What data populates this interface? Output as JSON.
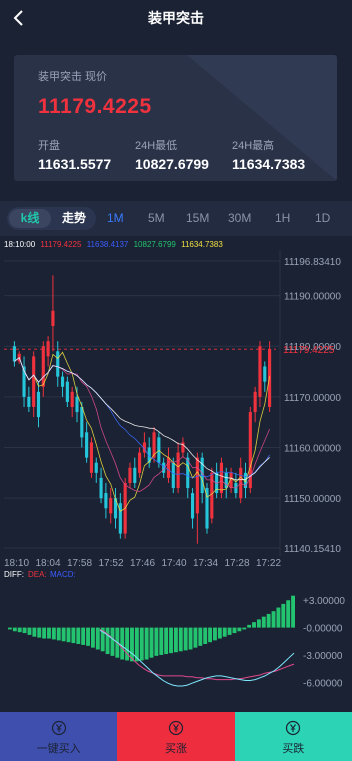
{
  "header": {
    "title": "装甲突击"
  },
  "ticker": {
    "symbol_label": "装甲突击 现价",
    "price": "11179.4225",
    "open_label": "开盘",
    "open_value": "11631.5577",
    "low_label": "24H最低",
    "low_value": "10827.6799",
    "high_label": "24H最高",
    "high_value": "11634.7383"
  },
  "chart_tabs": {
    "kline": "k线",
    "trend": "走势",
    "timeframes": [
      "1M",
      "5M",
      "15M",
      "30M",
      "1H",
      "1D"
    ],
    "active_timeframe": "1M"
  },
  "legend": {
    "time": "18:10:00",
    "v1": "11179.4225",
    "v2": "11638.4137",
    "v3": "10827.6799",
    "v4": "11634.7383"
  },
  "chart_data": [
    {
      "type": "candlestick",
      "y_ticks": [
        "11196.83410",
        "11190.00000",
        "11180.00000",
        "11170.00000",
        "11160.00000",
        "11150.00000",
        "11140.15410"
      ],
      "ylim": [
        11140.1541,
        11196.8341
      ],
      "x_ticks": [
        "18:10",
        "18:04",
        "17:58",
        "17:52",
        "17:46",
        "17:40",
        "17:34",
        "17:28",
        "17:22"
      ],
      "current_price_label": "11179.4225",
      "current_price": 11179.4225,
      "candles": [
        {
          "o": 11180,
          "c": 11177,
          "h": 11181,
          "l": 11176
        },
        {
          "o": 11177,
          "c": 11178.5,
          "h": 11179,
          "l": 11176.5
        },
        {
          "o": 11176,
          "c": 11170,
          "h": 11178,
          "l": 11168
        },
        {
          "o": 11170,
          "c": 11168,
          "h": 11172,
          "l": 11167
        },
        {
          "o": 11168,
          "c": 11178,
          "h": 11179,
          "l": 11166
        },
        {
          "o": 11171,
          "c": 11166,
          "h": 11173,
          "l": 11164
        },
        {
          "o": 11172,
          "c": 11180,
          "h": 11181,
          "l": 11170
        },
        {
          "o": 11178,
          "c": 11181,
          "h": 11182,
          "l": 11176
        },
        {
          "o": 11184,
          "c": 11187,
          "h": 11194,
          "l": 11179
        },
        {
          "o": 11179,
          "c": 11174,
          "h": 11181,
          "l": 11172
        },
        {
          "o": 11174,
          "c": 11172,
          "h": 11175,
          "l": 11170
        },
        {
          "o": 11173,
          "c": 11169,
          "h": 11174,
          "l": 11168
        },
        {
          "o": 11168,
          "c": 11171,
          "h": 11172,
          "l": 11166
        },
        {
          "o": 11170,
          "c": 11167,
          "h": 11172,
          "l": 11165
        },
        {
          "o": 11168,
          "c": 11162,
          "h": 11169,
          "l": 11160
        },
        {
          "o": 11163,
          "c": 11158,
          "h": 11165,
          "l": 11157
        },
        {
          "o": 11155,
          "c": 11161,
          "h": 11162,
          "l": 11154
        },
        {
          "o": 11157,
          "c": 11155,
          "h": 11158,
          "l": 11153
        },
        {
          "o": 11154,
          "c": 11150,
          "h": 11156,
          "l": 11149
        },
        {
          "o": 11151,
          "c": 11148,
          "h": 11153,
          "l": 11146
        },
        {
          "o": 11147,
          "c": 11150,
          "h": 11152,
          "l": 11145
        },
        {
          "o": 11150,
          "c": 11146,
          "h": 11152,
          "l": 11144
        },
        {
          "o": 11149,
          "c": 11143,
          "h": 11151,
          "l": 11142
        },
        {
          "o": 11143,
          "c": 11153,
          "h": 11154,
          "l": 11142
        },
        {
          "o": 11153,
          "c": 11156,
          "h": 11157,
          "l": 11152
        },
        {
          "o": 11156,
          "c": 11153,
          "h": 11158,
          "l": 11152
        },
        {
          "o": 11155,
          "c": 11159,
          "h": 11160,
          "l": 11154
        },
        {
          "o": 11159,
          "c": 11161,
          "h": 11163,
          "l": 11158
        },
        {
          "o": 11160,
          "c": 11157,
          "h": 11162,
          "l": 11156
        },
        {
          "o": 11158,
          "c": 11163,
          "h": 11164,
          "l": 11157
        },
        {
          "o": 11162,
          "c": 11157,
          "h": 11163,
          "l": 11156
        },
        {
          "o": 11157,
          "c": 11155,
          "h": 11158,
          "l": 11154
        },
        {
          "o": 11154,
          "c": 11158,
          "h": 11160,
          "l": 11153
        },
        {
          "o": 11157,
          "c": 11152,
          "h": 11158,
          "l": 11151
        },
        {
          "o": 11152,
          "c": 11159,
          "h": 11161,
          "l": 11151
        },
        {
          "o": 11159,
          "c": 11161,
          "h": 11162,
          "l": 11158
        },
        {
          "o": 11158,
          "c": 11152,
          "h": 11159,
          "l": 11150
        },
        {
          "o": 11151,
          "c": 11146,
          "h": 11152,
          "l": 11144
        },
        {
          "o": 11147,
          "c": 11158,
          "h": 11159,
          "l": 11141
        },
        {
          "o": 11158,
          "c": 11151,
          "h": 11159,
          "l": 11149
        },
        {
          "o": 11152,
          "c": 11144,
          "h": 11153,
          "l": 11143
        },
        {
          "o": 11146,
          "c": 11155,
          "h": 11156,
          "l": 11145
        },
        {
          "o": 11155,
          "c": 11151,
          "h": 11157,
          "l": 11150
        },
        {
          "o": 11151,
          "c": 11157,
          "h": 11158,
          "l": 11150
        },
        {
          "o": 11155,
          "c": 11152,
          "h": 11156,
          "l": 11150
        },
        {
          "o": 11152,
          "c": 11155,
          "h": 11156,
          "l": 11151
        },
        {
          "o": 11153,
          "c": 11151,
          "h": 11155,
          "l": 11150
        },
        {
          "o": 11150,
          "c": 11156,
          "h": 11158,
          "l": 11149
        },
        {
          "o": 11155,
          "c": 11152,
          "h": 11157,
          "l": 11150
        },
        {
          "o": 11152,
          "c": 11167,
          "h": 11168,
          "l": 11151
        },
        {
          "o": 11167,
          "c": 11171,
          "h": 11172,
          "l": 11165
        },
        {
          "o": 11170,
          "c": 11180,
          "h": 11181,
          "l": 11168
        },
        {
          "o": 11176,
          "c": 11173,
          "h": 11177,
          "l": 11171
        },
        {
          "o": 11168,
          "c": 11179.4225,
          "h": 11181,
          "l": 11167
        }
      ]
    },
    {
      "type": "macd",
      "labels": [
        "DIFF:",
        "DEA:",
        "MACD:"
      ],
      "y_ticks": [
        "+3.00000",
        "-0.00000",
        "-3.00000",
        "-6.00000"
      ],
      "ylim": [
        -7.5,
        5
      ],
      "histogram": [
        -0.2,
        -0.4,
        -0.5,
        -0.6,
        -0.8,
        -1.0,
        -1.1,
        -1.2,
        -1.2,
        -1.3,
        -1.4,
        -1.5,
        -1.6,
        -1.7,
        -1.8,
        -1.9,
        -2.0,
        -2.2,
        -2.4,
        -2.6,
        -2.9,
        -3.1,
        -3.3,
        -3.5,
        -3.6,
        -3.7,
        -3.7,
        -3.6,
        -3.5,
        -3.3,
        -3.1,
        -3.0,
        -2.9,
        -2.8,
        -2.7,
        -2.6,
        -2.5,
        -2.4,
        -2.2,
        -2.0,
        -1.8,
        -1.6,
        -1.4,
        -1.2,
        -1.0,
        -0.8,
        -0.6,
        -0.4,
        -0.2,
        0.3,
        0.6,
        0.9,
        1.2,
        1.5,
        1.8,
        2.2,
        2.6,
        3.0,
        3.5
      ],
      "diff": [
        -0.3,
        -0.6,
        -1.0,
        -1.4,
        -1.8,
        -2.2,
        -2.6,
        -3.0,
        -3.5,
        -4.0,
        -4.5,
        -5.0,
        -5.4,
        -5.8,
        -6.1,
        -6.3,
        -6.4,
        -6.4,
        -6.3,
        -6.1,
        -5.9,
        -5.7,
        -5.5,
        -5.4,
        -5.3,
        -5.3,
        -5.4,
        -5.5,
        -5.6,
        -5.7,
        -5.8,
        -5.8,
        -5.7,
        -5.5,
        -5.3,
        -5.0,
        -4.7,
        -4.3,
        -3.8,
        -3.3,
        -2.8
      ],
      "dea": [
        -0.2,
        -0.5,
        -0.9,
        -1.4,
        -1.9,
        -2.5,
        -3.1,
        -3.6,
        -4.1,
        -4.5,
        -4.8,
        -5.0,
        -5.2,
        -5.3,
        -5.3,
        -5.3,
        -5.3,
        -5.3,
        -5.4,
        -5.4,
        -5.5,
        -5.5,
        -5.6,
        -5.6,
        -5.7,
        -5.7,
        -5.7,
        -5.7,
        -5.6,
        -5.6,
        -5.5,
        -5.4,
        -5.3,
        -5.2,
        -5.0,
        -4.9,
        -4.8,
        -4.6,
        -4.4,
        -4.2,
        -4.0
      ]
    }
  ],
  "footer": {
    "buttons": [
      {
        "label": "一键买入",
        "color": "#3e4fae"
      },
      {
        "label": "买涨",
        "color": "#ee2d3e"
      },
      {
        "label": "买跌",
        "color": "#2cd3b5"
      }
    ]
  },
  "colors": {
    "up": "#f0323e",
    "down": "#26c6da",
    "macd_pos": "#23c36f",
    "macd_neg": "#23c36f",
    "ma1": "#ffffff",
    "ma2": "#f0e040",
    "ma3": "#e04a8e",
    "ma4": "#3c6cff"
  }
}
